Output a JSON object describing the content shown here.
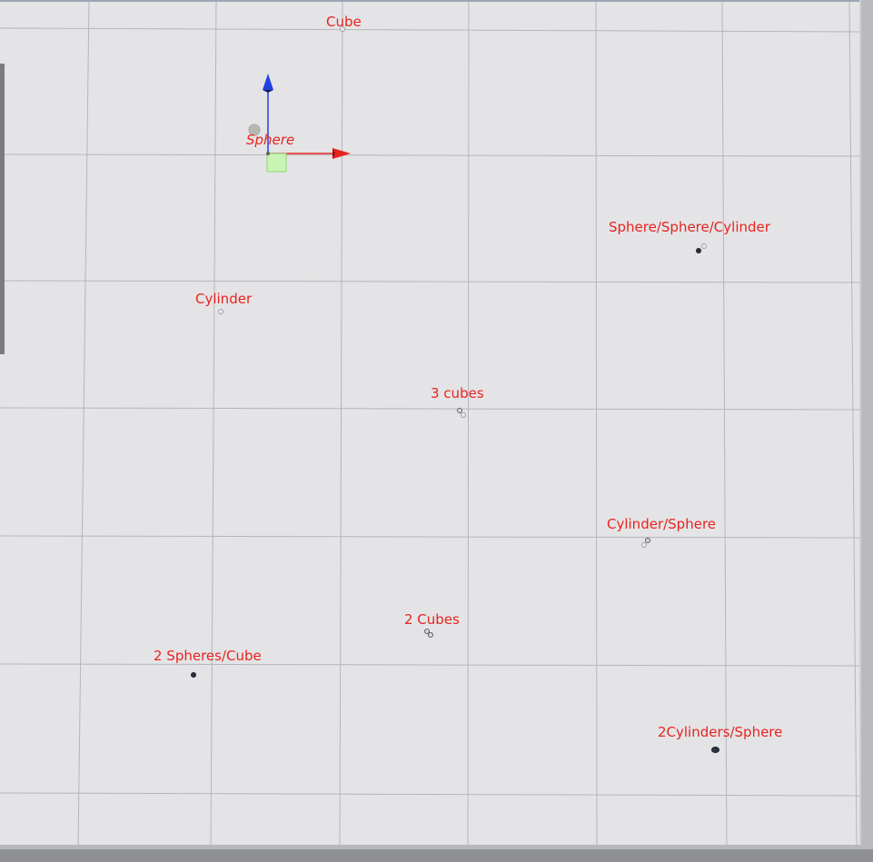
{
  "scene": {
    "labels": {
      "cube": "Cube",
      "sphere": "Sphere",
      "sphere_sphere_cylinder": "Sphere/Sphere/Cylinder",
      "cylinder": "Cylinder",
      "three_cubes": "3 cubes",
      "cylinder_sphere": "Cylinder/Sphere",
      "two_cubes": "2 Cubes",
      "two_spheres_cube": "2 Spheres/Cube",
      "two_cylinders_sphere": "2Cylinders/Sphere"
    },
    "selected_object": "Sphere"
  },
  "gizmo": {
    "x_axis_color": "#e8231f",
    "y_axis_color": "#2440e0",
    "center_handle_color": "#c8f5b4"
  },
  "colors": {
    "background": "#e4e4e6",
    "grid_line": "#b3b5b9",
    "label": "#e8231f"
  }
}
